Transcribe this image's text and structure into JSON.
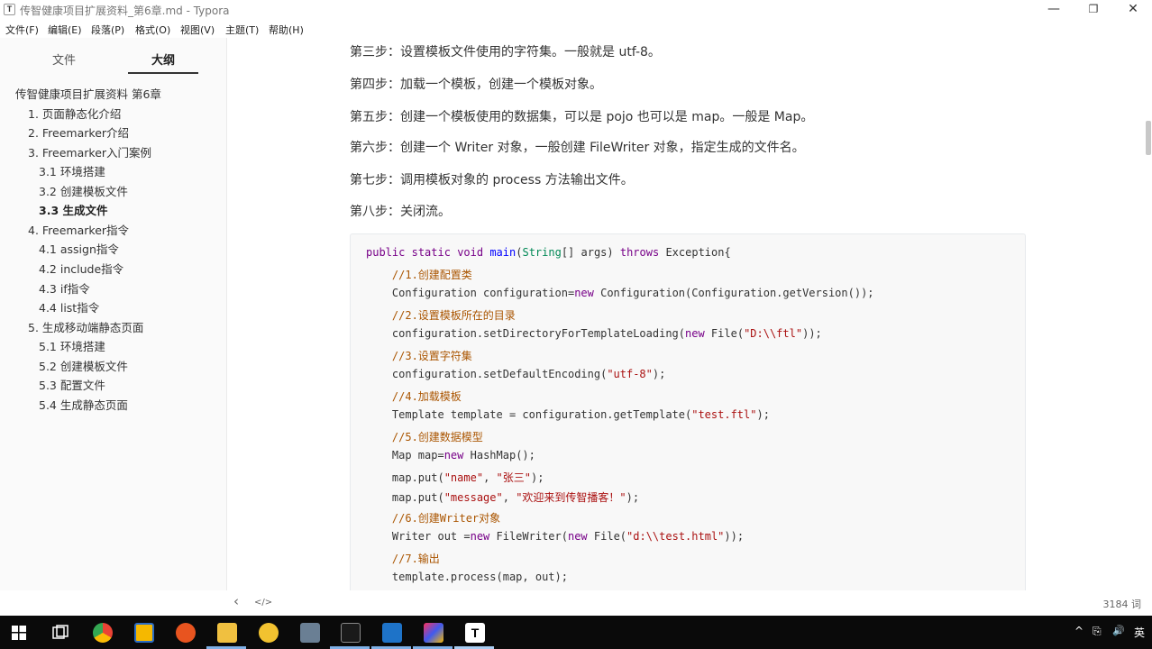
{
  "window": {
    "title": "传智健康项目扩展资料_第6章.md - Typora",
    "app_icon": "T",
    "controls": {
      "minimize": "—",
      "maximize": "❐",
      "close": "✕"
    }
  },
  "menu": [
    "文件(F)",
    "编辑(E)",
    "段落(P)",
    "格式(O)",
    "视图(V)",
    "主题(T)",
    "帮助(H)"
  ],
  "sidebar": {
    "tabs": [
      {
        "label": "文件",
        "active": false
      },
      {
        "label": "大纲",
        "active": true
      }
    ],
    "outline": [
      {
        "label": "传智健康项目扩展资料 第6章",
        "level": 0
      },
      {
        "label": "1. 页面静态化介绍",
        "level": 1
      },
      {
        "label": "2. Freemarker介绍",
        "level": 1
      },
      {
        "label": "3. Freemarker入门案例",
        "level": 1
      },
      {
        "label": "3.1 环境搭建",
        "level": 2
      },
      {
        "label": "3.2 创建模板文件",
        "level": 2
      },
      {
        "label": "3.3 生成文件",
        "level": 2,
        "active": true
      },
      {
        "label": "4. Freemarker指令",
        "level": 1
      },
      {
        "label": "4.1 assign指令",
        "level": 2
      },
      {
        "label": "4.2 include指令",
        "level": 2
      },
      {
        "label": "4.3 if指令",
        "level": 2
      },
      {
        "label": "4.4 list指令",
        "level": 2
      },
      {
        "label": "5. 生成移动端静态页面",
        "level": 1
      },
      {
        "label": "5.1 环境搭建",
        "level": 2
      },
      {
        "label": "5.2 创建模板文件",
        "level": 2
      },
      {
        "label": "5.3 配置文件",
        "level": 2
      },
      {
        "label": "5.4 生成静态页面",
        "level": 2
      }
    ]
  },
  "content": {
    "paragraphs": [
      "第三步：设置模板文件使用的字符集。一般就是 utf-8。",
      "第四步：加载一个模板，创建一个模板对象。",
      "第五步：创建一个模板使用的数据集，可以是 pojo 也可以是 map。一般是 Map。",
      "第六步：创建一个 Writer 对象，一般创建 FileWriter 对象，指定生成的文件名。",
      "第七步：调用模板对象的 process 方法输出文件。",
      "第八步：关闭流。"
    ],
    "code": [
      "public static void main(String[] args) throws Exception{",
      "    //1.创建配置类",
      "    Configuration configuration=new Configuration(Configuration.getVersion());",
      "    //2.设置模板所在的目录",
      "    configuration.setDirectoryForTemplateLoading(new File(\"D:\\\\ftl\"));",
      "    //3.设置字符集",
      "    configuration.setDefaultEncoding(\"utf-8\");",
      "    //4.加载模板",
      "    Template template = configuration.getTemplate(\"test.ftl\");",
      "    //5.创建数据模型",
      "    Map map=new HashMap();",
      "    map.put(\"name\", \"张三\");",
      "    map.put(\"message\", \"欢迎来到传智播客！\");",
      "    //6.创建Writer对象",
      "    Writer out =new FileWriter(new File(\"d:\\\\test.html\"));",
      "    //7.输出",
      "    template.process(map, out);"
    ]
  },
  "statusbar": {
    "toggle_sidebar": "‹",
    "source_mode": "</>",
    "word_count": "3184 词"
  },
  "taskbar": {
    "start_icon": "windows-start-icon",
    "tray_lang": "英",
    "tray_icons": [
      "^",
      "⎘",
      "🔊"
    ],
    "accent_color": "#7fb0e6"
  }
}
